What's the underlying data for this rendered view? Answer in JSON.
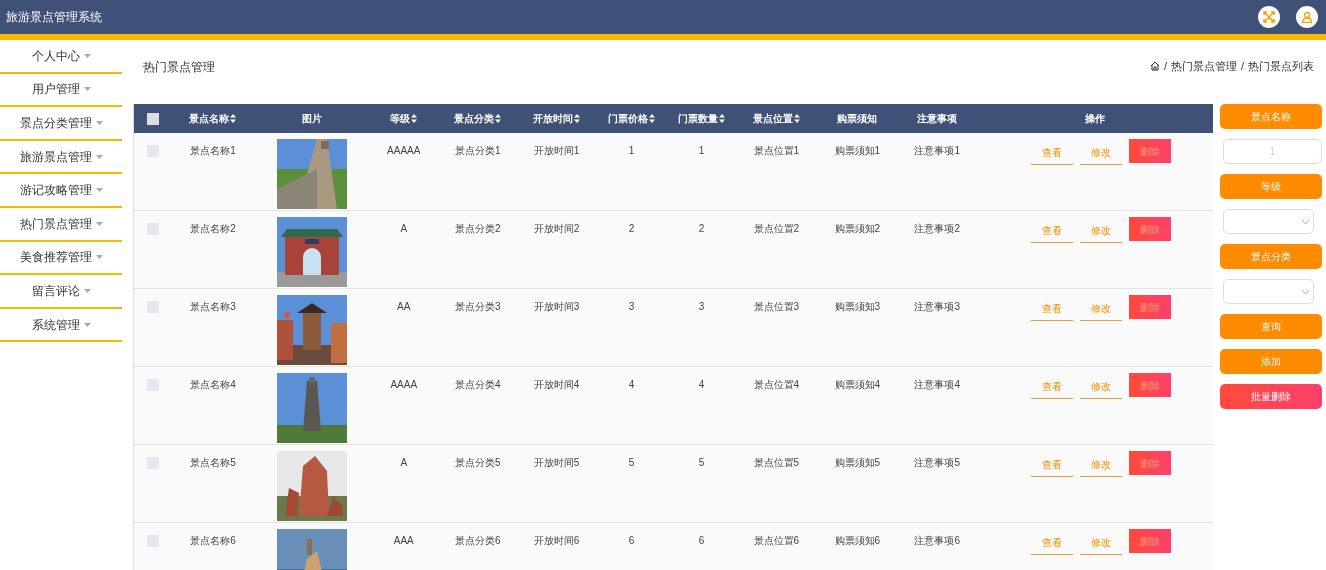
{
  "header": {
    "title": "旅游景点管理系统"
  },
  "sidebar": {
    "items": [
      {
        "label": "个人中心"
      },
      {
        "label": "用户管理"
      },
      {
        "label": "景点分类管理"
      },
      {
        "label": "旅游景点管理"
      },
      {
        "label": "游记攻略管理"
      },
      {
        "label": "热门景点管理"
      },
      {
        "label": "美食推荐管理"
      },
      {
        "label": "留言评论"
      },
      {
        "label": "系统管理"
      }
    ]
  },
  "page_title": "热门景点管理",
  "breadcrumb": [
    {
      "separator": "/",
      "label": "热门景点管理"
    },
    {
      "separator": "/",
      "label": "热门景点列表"
    }
  ],
  "table": {
    "select_all": {
      "checked": false
    },
    "columns": [
      {
        "label": "景点名称",
        "sortable": true
      },
      {
        "label": "图片",
        "sortable": false
      },
      {
        "label": "等级",
        "sortable": true
      },
      {
        "label": "景点分类",
        "sortable": true
      },
      {
        "label": "开放时间",
        "sortable": true
      },
      {
        "label": "门票价格",
        "sortable": true
      },
      {
        "label": "门票数量",
        "sortable": true
      },
      {
        "label": "景点位置",
        "sortable": true
      },
      {
        "label": "购票须知",
        "sortable": false
      },
      {
        "label": "注意事项",
        "sortable": false
      },
      {
        "label": "操作",
        "sortable": false
      }
    ],
    "rows": [
      {
        "checked": false,
        "cells": [
          "景点名称1",
          {
            "kind": "picture"
          },
          "AAAAA",
          "景点分类1",
          "开放时间1",
          "1",
          "1",
          "景点位置1",
          "购票须知1",
          "注意事项1"
        ],
        "actions": [
          {
            "kind": "link",
            "label": "查看"
          },
          {
            "kind": "link",
            "label": "修改"
          },
          {
            "kind": "danger",
            "label": "删除"
          }
        ]
      },
      {
        "checked": false,
        "cells": [
          "景点名称2",
          {
            "kind": "picture"
          },
          "A",
          "景点分类2",
          "开放时间2",
          "2",
          "2",
          "景点位置2",
          "购票须知2",
          "注意事项2"
        ],
        "actions": [
          {
            "kind": "link",
            "label": "查看"
          },
          {
            "kind": "link",
            "label": "修改"
          },
          {
            "kind": "danger",
            "label": "删除"
          }
        ]
      },
      {
        "checked": false,
        "cells": [
          "景点名称3",
          {
            "kind": "picture"
          },
          "AA",
          "景点分类3",
          "开放时间3",
          "3",
          "3",
          "景点位置3",
          "购票须知3",
          "注意事项3"
        ],
        "actions": [
          {
            "kind": "link",
            "label": "查看"
          },
          {
            "kind": "link",
            "label": "修改"
          },
          {
            "kind": "danger",
            "label": "删除"
          }
        ]
      },
      {
        "checked": false,
        "cells": [
          "景点名称4",
          {
            "kind": "picture"
          },
          "AAAA",
          "景点分类4",
          "开放时间4",
          "4",
          "4",
          "景点位置4",
          "购票须知4",
          "注意事项4"
        ],
        "actions": [
          {
            "kind": "link",
            "label": "查看"
          },
          {
            "kind": "link",
            "label": "修改"
          },
          {
            "kind": "danger",
            "label": "删除"
          }
        ]
      },
      {
        "checked": false,
        "cells": [
          "景点名称5",
          {
            "kind": "picture"
          },
          "A",
          "景点分类5",
          "开放时间5",
          "5",
          "5",
          "景点位置5",
          "购票须知5",
          "注意事项5"
        ],
        "actions": [
          {
            "kind": "link",
            "label": "查看"
          },
          {
            "kind": "link",
            "label": "修改"
          },
          {
            "kind": "danger",
            "label": "删除"
          }
        ]
      },
      {
        "checked": false,
        "cells": [
          "景点名称6",
          {
            "kind": "picture"
          },
          "AAA",
          "景点分类6",
          "开放时间6",
          "6",
          "6",
          "景点位置6",
          "购票须知6",
          "注意事项6"
        ],
        "actions": [
          {
            "kind": "link",
            "label": "查看"
          },
          {
            "kind": "link",
            "label": "修改"
          },
          {
            "kind": "danger",
            "label": "删除"
          }
        ]
      }
    ]
  },
  "search_panel": [
    {
      "kind": "label",
      "label": "景点名称"
    },
    {
      "kind": "input",
      "placeholder": "1"
    },
    {
      "kind": "label",
      "label": "等级"
    },
    {
      "kind": "select"
    },
    {
      "kind": "label",
      "label": "景点分类"
    },
    {
      "kind": "select"
    },
    {
      "kind": "button",
      "label": "查询"
    },
    {
      "kind": "button",
      "label": "添加"
    },
    {
      "kind": "danger",
      "label": "批量删除"
    }
  ]
}
